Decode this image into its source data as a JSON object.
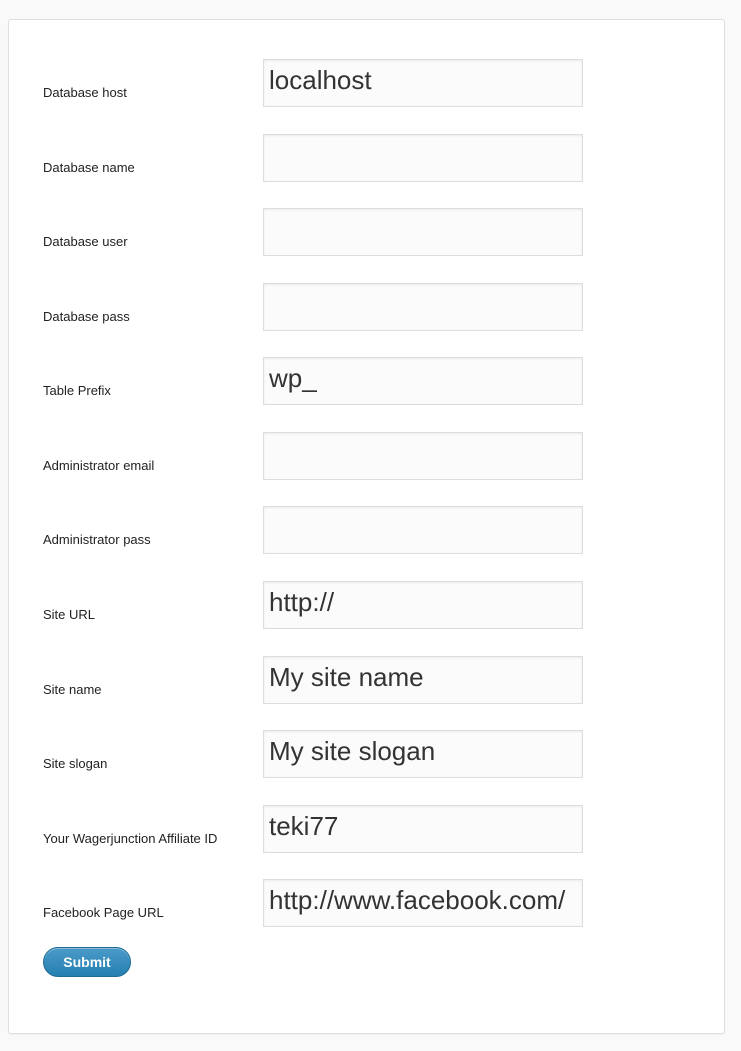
{
  "form": {
    "fields": [
      {
        "label": "Database host",
        "value": "localhost"
      },
      {
        "label": "Database name",
        "value": ""
      },
      {
        "label": "Database user",
        "value": ""
      },
      {
        "label": "Database pass",
        "value": ""
      },
      {
        "label": "Table Prefix",
        "value": "wp_"
      },
      {
        "label": "Administrator email",
        "value": ""
      },
      {
        "label": "Administrator pass",
        "value": ""
      },
      {
        "label": "Site URL",
        "value": "http://"
      },
      {
        "label": "Site name",
        "value": "My site name"
      },
      {
        "label": "Site slogan",
        "value": "My site slogan"
      },
      {
        "label": "Your Wagerjunction Affiliate ID",
        "value": "teki77"
      },
      {
        "label": "Facebook Page URL",
        "value": "http://www.facebook.com/"
      }
    ],
    "submit_label": "Submit"
  }
}
